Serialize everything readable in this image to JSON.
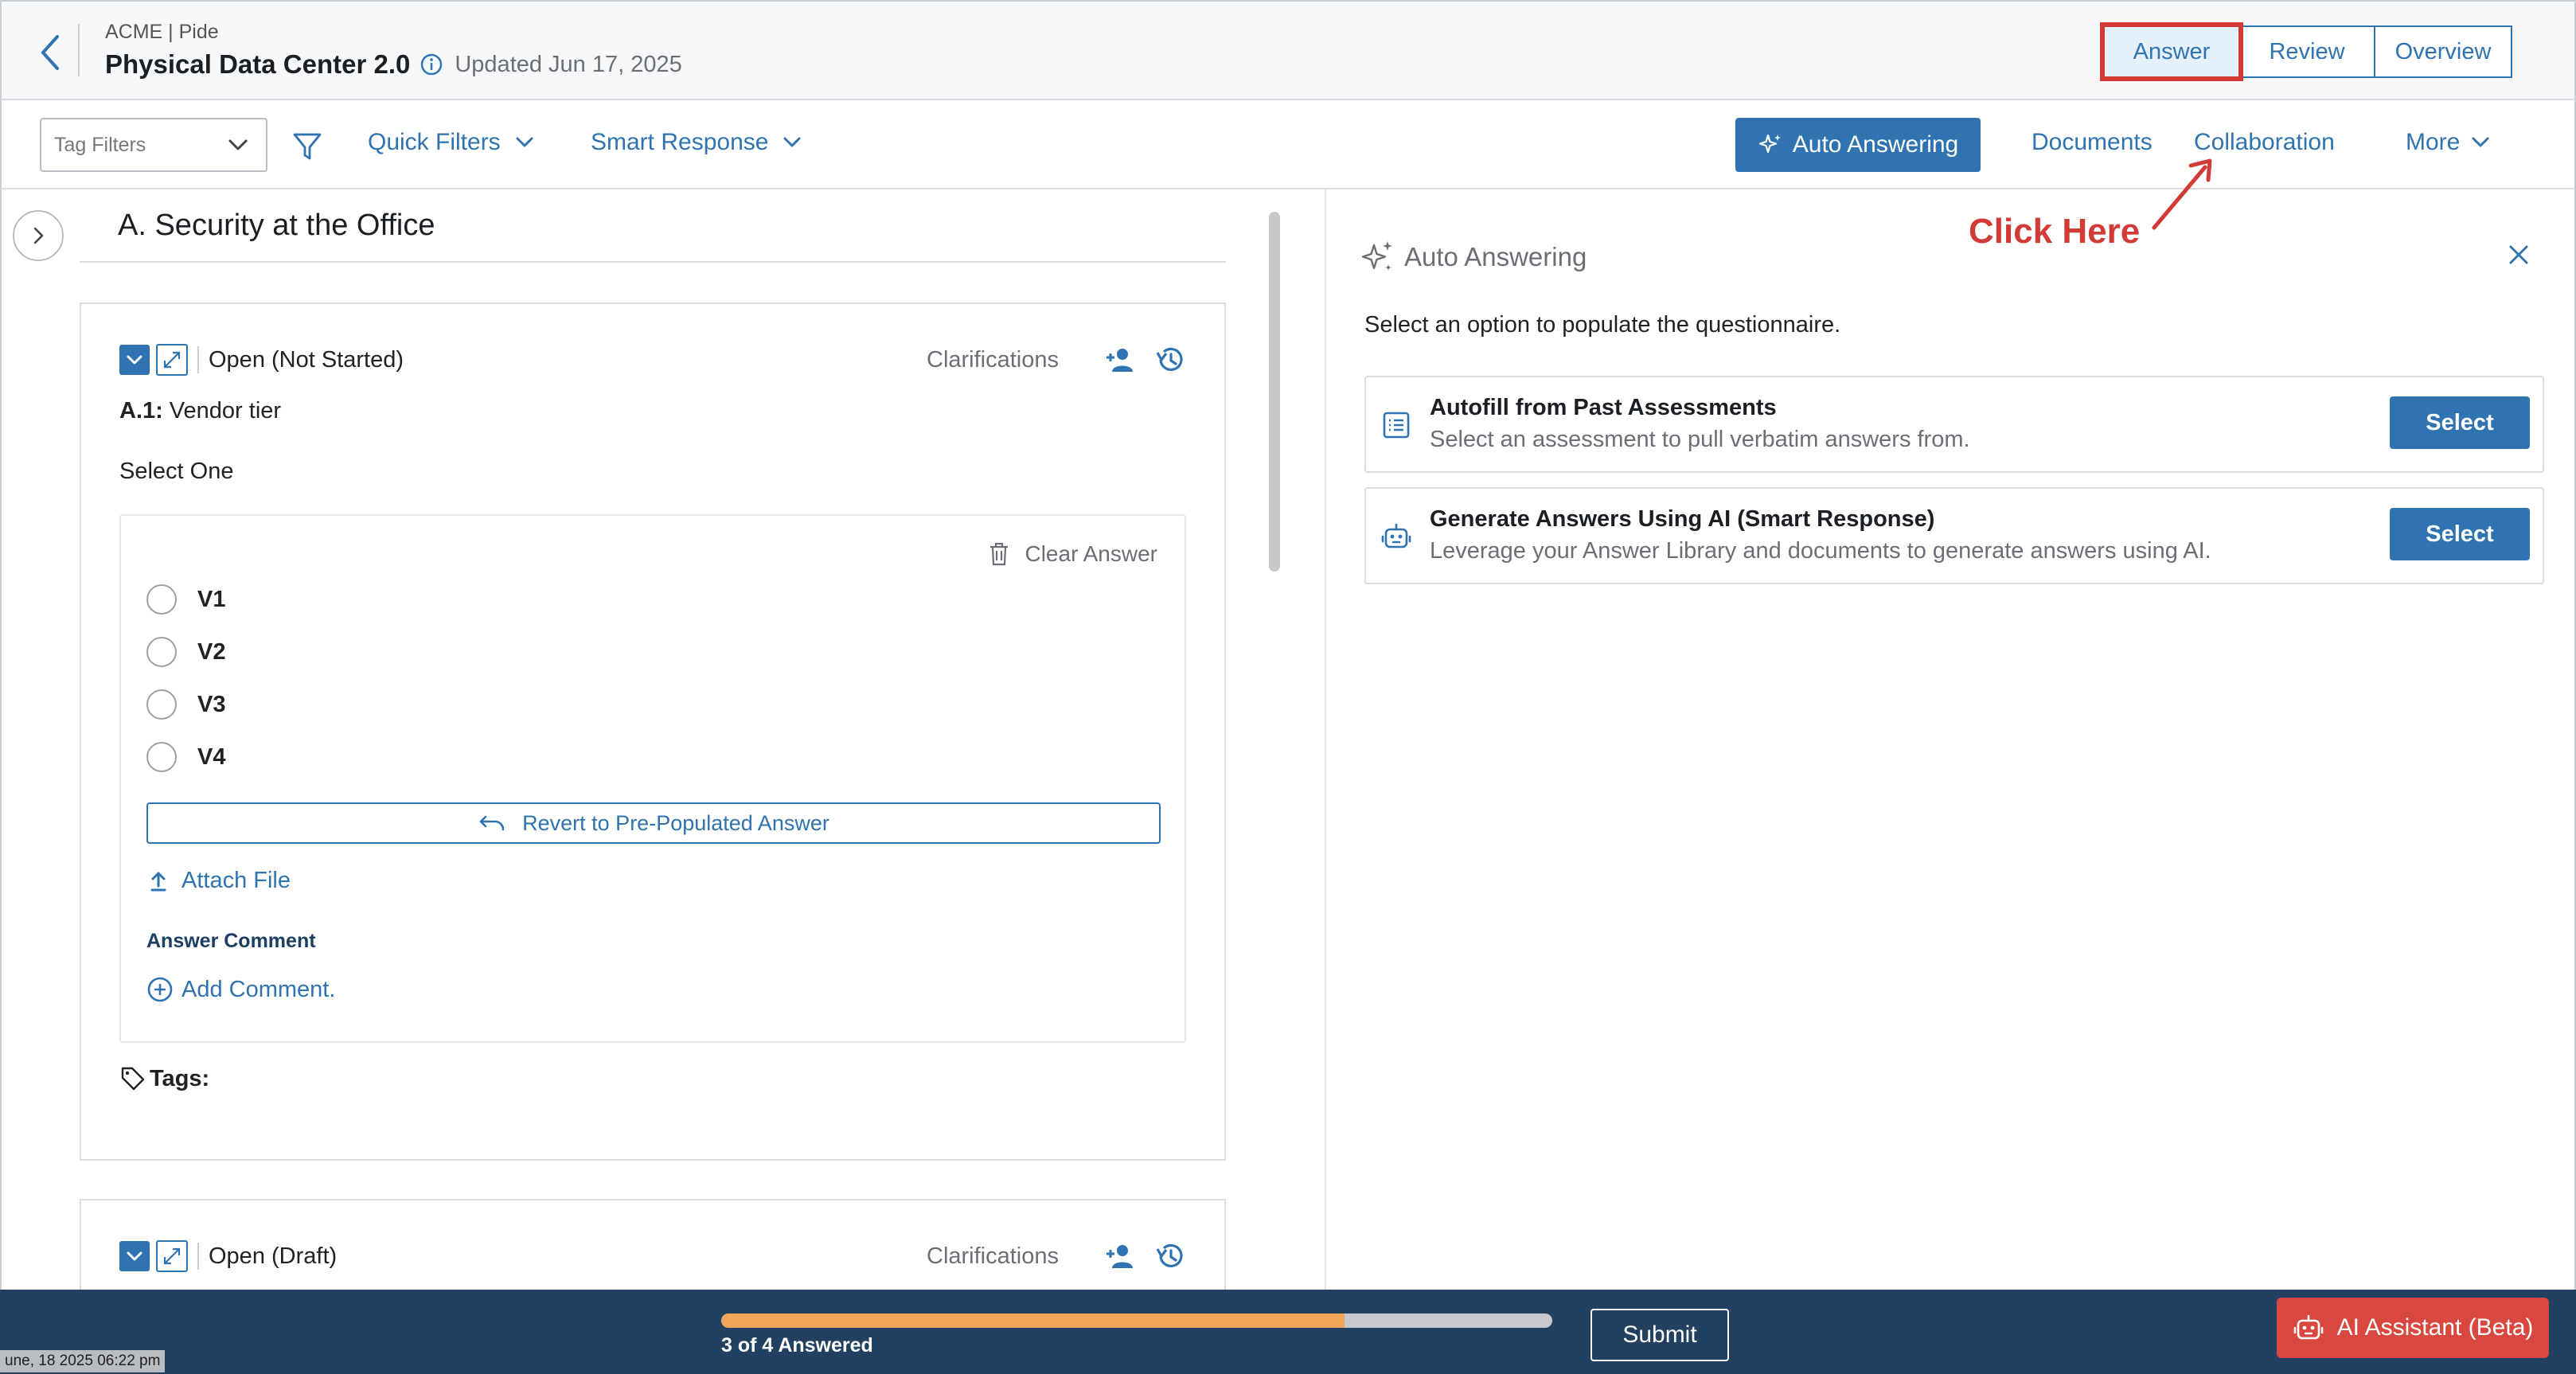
{
  "header": {
    "org": "ACME | Pide",
    "title": "Physical Data Center 2.0",
    "updated": "Updated Jun 17, 2025",
    "tabs": [
      {
        "label": "Answer",
        "active": true
      },
      {
        "label": "Review",
        "active": false
      },
      {
        "label": "Overview",
        "active": false
      }
    ]
  },
  "toolbar": {
    "tag_filters": "Tag Filters",
    "quick_filters": "Quick Filters",
    "smart_response": "Smart Response",
    "auto_answering": "Auto Answering",
    "documents": "Documents",
    "collaboration": "Collaboration",
    "more": "More"
  },
  "section": {
    "title": "A. Security at the Office"
  },
  "questions": [
    {
      "status": "Open (Not Started)",
      "clarifications": "Clarifications",
      "id": "A.1:",
      "text": "Vendor tier",
      "select_label": "Select One",
      "clear_answer": "Clear Answer",
      "options": [
        "V1",
        "V2",
        "V3",
        "V4"
      ],
      "revert": "Revert to Pre-Populated Answer",
      "attach": "Attach File",
      "comment_label": "Answer Comment",
      "add_comment": "Add Comment.",
      "tags": "Tags:"
    },
    {
      "status": "Open (Draft)",
      "clarifications": "Clarifications"
    }
  ],
  "auto_panel": {
    "title": "Auto Answering",
    "description": "Select an option to populate the questionnaire.",
    "options": [
      {
        "title": "Autofill from Past Assessments",
        "desc": "Select an assessment to pull verbatim answers from.",
        "button": "Select",
        "icon": "checklist-icon"
      },
      {
        "title": "Generate Answers Using AI (Smart Response)",
        "desc": "Leverage your Answer Library and documents to generate answers using AI.",
        "button": "Select",
        "icon": "robot-icon"
      }
    ]
  },
  "annotation": {
    "text": "Click Here",
    "color": "#d23a35"
  },
  "footer": {
    "progress_label": "3 of 4 Answered",
    "answered": 3,
    "total": 4,
    "submit": "Submit",
    "ai_assistant": "AI Assistant (Beta)",
    "timestamp": "une, 18 2025 06:22 pm"
  },
  "colors": {
    "primary": "#2f73b0",
    "footer_bg": "#22405f",
    "progress": "#f2a65a",
    "ai_button": "#d9483f"
  }
}
